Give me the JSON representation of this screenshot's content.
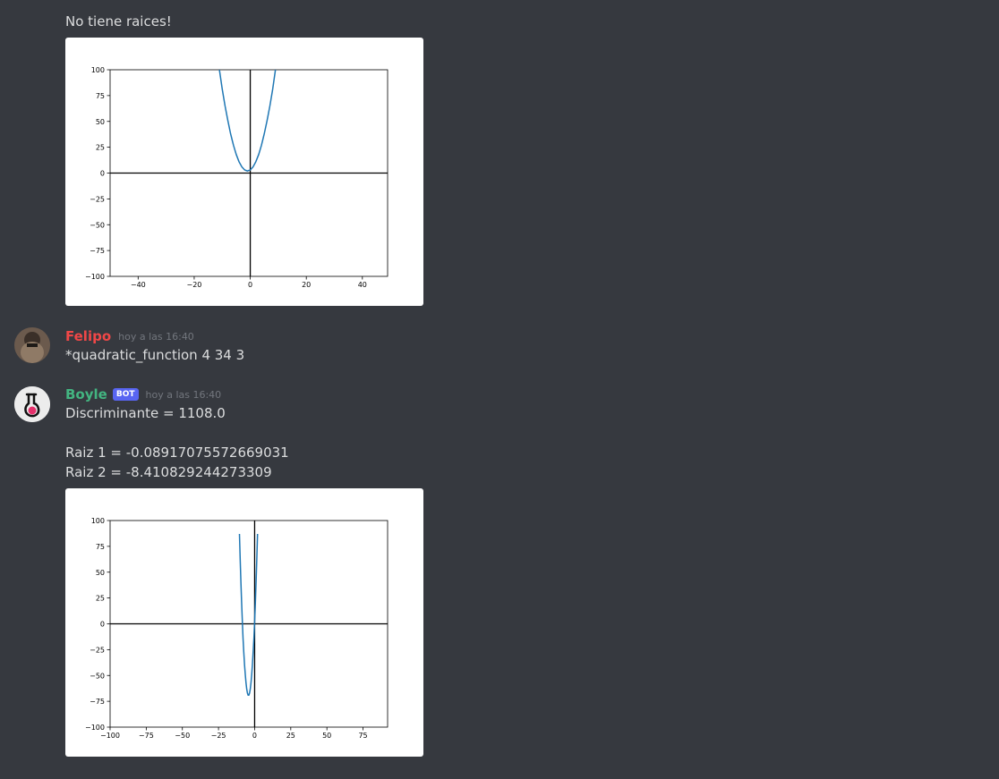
{
  "messages": [
    {
      "continuation_text": "No tiene raices!"
    },
    {
      "author": "Felipo",
      "author_color": "#f04747",
      "timestamp": "hoy a las 16:40",
      "text": "*quadratic_function 4 34 3"
    },
    {
      "author": "Boyle",
      "author_color": "#43b581",
      "bot_tag": "BOT",
      "timestamp": "hoy a las 16:40",
      "lines": [
        "Discriminante = 1108.0",
        "",
        "Raiz 1 = -0.08917075572669031",
        "Raiz 2 = -8.410829244273309"
      ]
    }
  ],
  "chart_data": [
    {
      "type": "line",
      "title": "",
      "xlabel": "",
      "ylabel": "",
      "xlim": [
        -50,
        49
      ],
      "ylim": [
        -100,
        100
      ],
      "xticks": [
        -40,
        -20,
        0,
        20,
        40
      ],
      "xtick_labels": [
        "−40",
        "−20",
        "0",
        "20",
        "40"
      ],
      "yticks": [
        100,
        75,
        50,
        25,
        0,
        -25,
        -50,
        -75,
        -100
      ],
      "ytick_labels": [
        "100",
        "75",
        "50",
        "25",
        "0",
        "−25",
        "−50",
        "−75",
        "−100"
      ],
      "series": [
        {
          "color": "#1f77b4",
          "x": [
            -11,
            -10,
            -9,
            -8,
            -7,
            -6,
            -5,
            -4,
            -3,
            -2,
            -1,
            0,
            1,
            2,
            3,
            4,
            5,
            6,
            7,
            8,
            9
          ],
          "y": [
            100,
            81,
            65,
            51,
            38,
            27,
            18,
            11,
            6,
            3,
            2,
            3,
            6,
            11,
            18,
            27,
            38,
            51,
            65,
            81,
            100
          ]
        }
      ],
      "axes_lines": {
        "x": 0,
        "y": 0
      },
      "grid": false
    },
    {
      "type": "line",
      "title": "",
      "xlabel": "",
      "ylabel": "",
      "xlim": [
        -100,
        92
      ],
      "ylim": [
        -100,
        100
      ],
      "xticks": [
        -100,
        -75,
        -50,
        -25,
        0,
        25,
        50,
        75
      ],
      "xtick_labels": [
        "−100",
        "−75",
        "−50",
        "−25",
        "0",
        "25",
        "50",
        "75"
      ],
      "yticks": [
        100,
        75,
        50,
        25,
        0,
        -25,
        -50,
        -75,
        -100
      ],
      "ytick_labels": [
        "100",
        "75",
        "50",
        "25",
        "0",
        "−25",
        "−50",
        "−75",
        "−100"
      ],
      "series": [
        {
          "color": "#1f77b4",
          "x": [
            -10.5,
            -10,
            -9.5,
            -9,
            -8.5,
            -8,
            -7.5,
            -7,
            -6.5,
            -6,
            -5.5,
            -5,
            -4.5,
            -4,
            -3.5,
            -3,
            -2.5,
            -2,
            -1.5,
            -1,
            -0.5,
            0,
            0.5,
            1,
            1.5,
            2
          ],
          "y": [
            87,
            63,
            41,
            21,
            3,
            -14,
            -27,
            -40,
            -49,
            -57,
            -63,
            -67,
            -69,
            -69,
            -67,
            -63,
            -57,
            -49,
            -39,
            -27,
            -13,
            3,
            21,
            41,
            63,
            87
          ]
        }
      ],
      "axes_lines": {
        "x": 0,
        "y": 0
      },
      "grid": false
    }
  ]
}
